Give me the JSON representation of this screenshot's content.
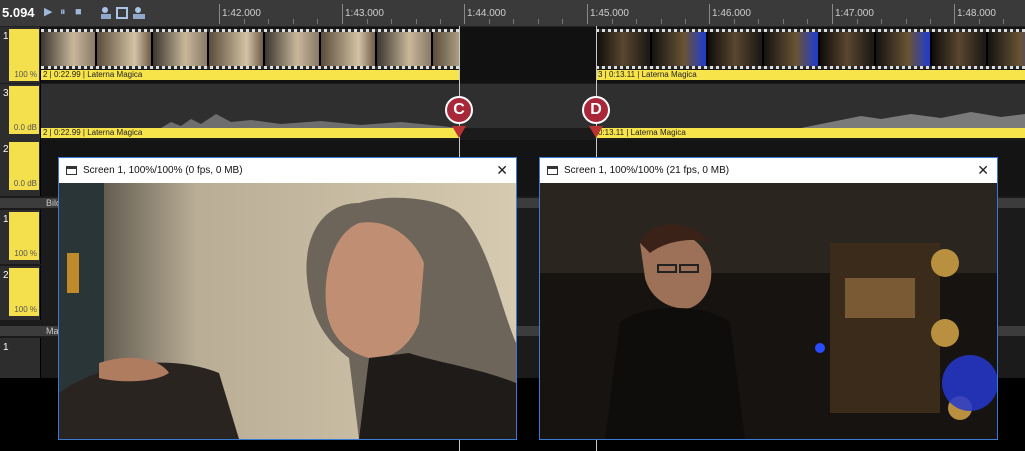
{
  "toolbar": {
    "timecode": "5.094",
    "play_label": "▶",
    "pause_label": "⏸",
    "stop_label": "■",
    "icons": [
      "play-icon",
      "pause-icon",
      "stop-icon",
      "tool-icon-1",
      "tool-icon-2",
      "tool-icon-3"
    ]
  },
  "ruler": {
    "ticks": [
      "1:42.000",
      "1:43.000",
      "1:44.000",
      "1:45.000",
      "1:46.000",
      "1:47.000",
      "1:48.000"
    ]
  },
  "tracks": {
    "video1": {
      "number": "1",
      "percent": "100 %"
    },
    "audio3": {
      "number": "3",
      "level": "0.0 dB"
    },
    "track2": {
      "number": "2",
      "level": "0.0 dB"
    },
    "group1_label": "Bild",
    "sub1": {
      "number": "1",
      "percent": "100 %"
    },
    "sub2": {
      "number": "2",
      "percent": "100 %"
    },
    "group2_label": "Ma",
    "sub3": {
      "number": "1"
    }
  },
  "clips": {
    "video_left_label": "2 | 0:22.99 | Laterna Magica",
    "video_right_label": "3 | 0:13.11 | Laterna Magica",
    "audio_left_label": "2 | 0:22.99 | Laterna Magica",
    "audio_right_label": "0:13.11 | Laterna Magica"
  },
  "markers": {
    "c": "C",
    "d": "D"
  },
  "windows": {
    "left": {
      "title": "Screen 1, 100%/100% (0 fps, 0 MB)",
      "close": "✕"
    },
    "right": {
      "title": "Screen 1, 100%/100% (21 fps, 0 MB)",
      "close": "✕"
    }
  },
  "colors": {
    "clip_yellow": "#f7e34a",
    "marker_red": "#a8283a",
    "window_border": "#3a7bd5"
  }
}
